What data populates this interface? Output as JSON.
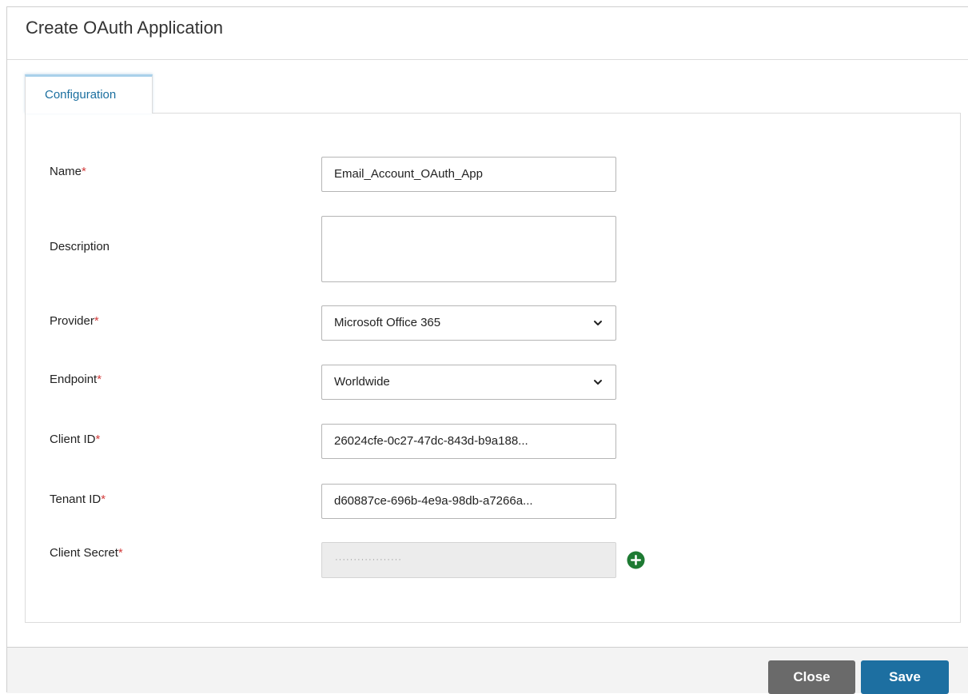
{
  "dialog": {
    "title": "Create OAuth Application"
  },
  "tabs": [
    {
      "label": "Configuration",
      "active": true
    }
  ],
  "form": {
    "required_marker": "*",
    "name": {
      "label": "Name",
      "value": "Email_Account_OAuth_App"
    },
    "description": {
      "label": "Description",
      "value": ""
    },
    "provider": {
      "label": "Provider",
      "value": "Microsoft Office 365"
    },
    "endpoint": {
      "label": "Endpoint",
      "value": "Worldwide"
    },
    "client_id": {
      "label": "Client ID",
      "value": "26024cfe-0c27-47dc-843d-b9a188..."
    },
    "tenant_id": {
      "label": "Tenant ID",
      "value": "d60887ce-696b-4e9a-98db-a7266a..."
    },
    "client_secret": {
      "label": "Client Secret",
      "value": "··················",
      "disabled": true
    }
  },
  "icons": {
    "dropdown": "chevron-down-icon",
    "add_secret": "plus-circle-icon"
  },
  "footer": {
    "close_label": "Close",
    "save_label": "Save"
  },
  "colors": {
    "tab_text": "#1b6f9f",
    "required": "#d33c3c",
    "add_icon": "#1e7a33",
    "close_button": "#6a6a6a",
    "save_button": "#1d6fa1"
  }
}
